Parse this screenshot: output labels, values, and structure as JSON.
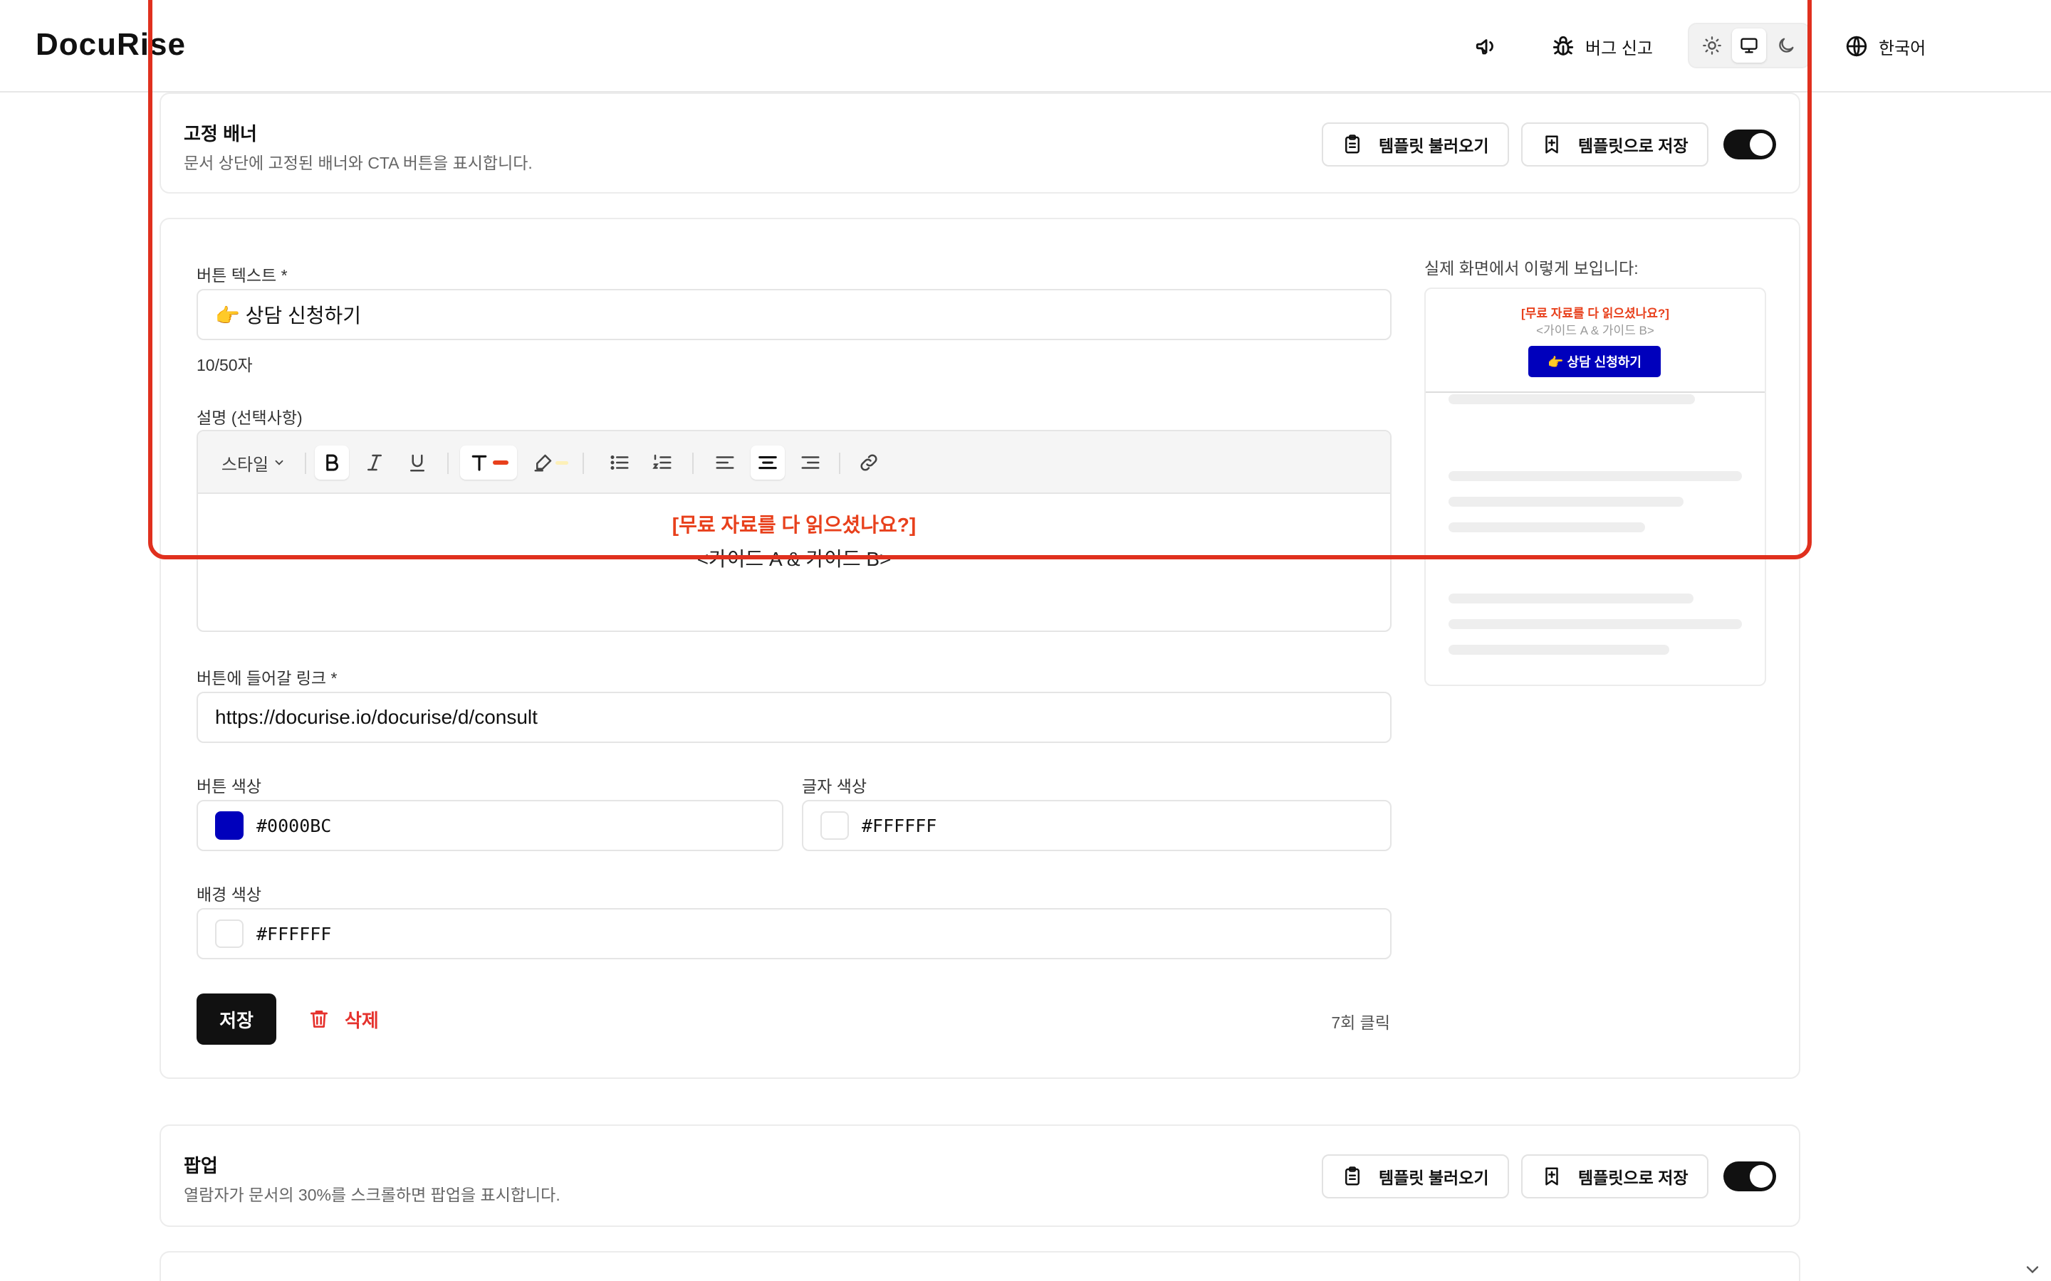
{
  "header": {
    "logo": "DocuRise",
    "bug_report_label": "버그 신고",
    "language_label": "한국어",
    "theme_options": [
      "light",
      "system",
      "dark"
    ],
    "active_theme": "system"
  },
  "sticky_banner": {
    "title": "고정 배너",
    "description": "문서 상단에 고정된 배너와 CTA 버튼을 표시합니다.",
    "load_template_label": "템플릿 불러오기",
    "save_template_label": "템플릿으로 저장",
    "enabled": true
  },
  "form": {
    "button_text_label": "버튼 텍스트 *",
    "button_text_value": "👉 상담 신청하기",
    "char_count": "10/50자",
    "description_label": "설명 (선택사항)",
    "toolbar": {
      "style_label": "스타일"
    },
    "editor_line1": "[무료 자료를 다 읽으셨나요?]",
    "editor_line2": "<가이드 A & 가이드 B>",
    "link_label": "버튼에 들어갈 링크 *",
    "link_value": "https://docurise.io/docurise/d/consult",
    "button_color_label": "버튼 색상",
    "button_color_value": "#0000BC",
    "text_color_label": "글자 색상",
    "text_color_value": "#FFFFFF",
    "bg_color_label": "배경 색상",
    "bg_color_value": "#FFFFFF",
    "save_label": "저장",
    "delete_label": "삭제",
    "click_count": "7회 클릭"
  },
  "preview": {
    "label": "실제 화면에서 이렇게 보입니다:",
    "line1": "[무료 자료를 다 읽으셨나요?]",
    "line2": "<가이드 A & 가이드 B>",
    "button_text": "👉 상담 신청하기"
  },
  "popup": {
    "title": "팝업",
    "description": "열람자가 문서의 30%를 스크롤하면 팝업을 표시합니다.",
    "load_template_label": "템플릿 불러오기",
    "save_template_label": "템플릿으로 저장",
    "enabled": true
  },
  "colors": {
    "accent_red": "#e8401c",
    "button_blue": "#0000bc",
    "toggle_on": "#111111",
    "highlight": "#e0301e"
  }
}
